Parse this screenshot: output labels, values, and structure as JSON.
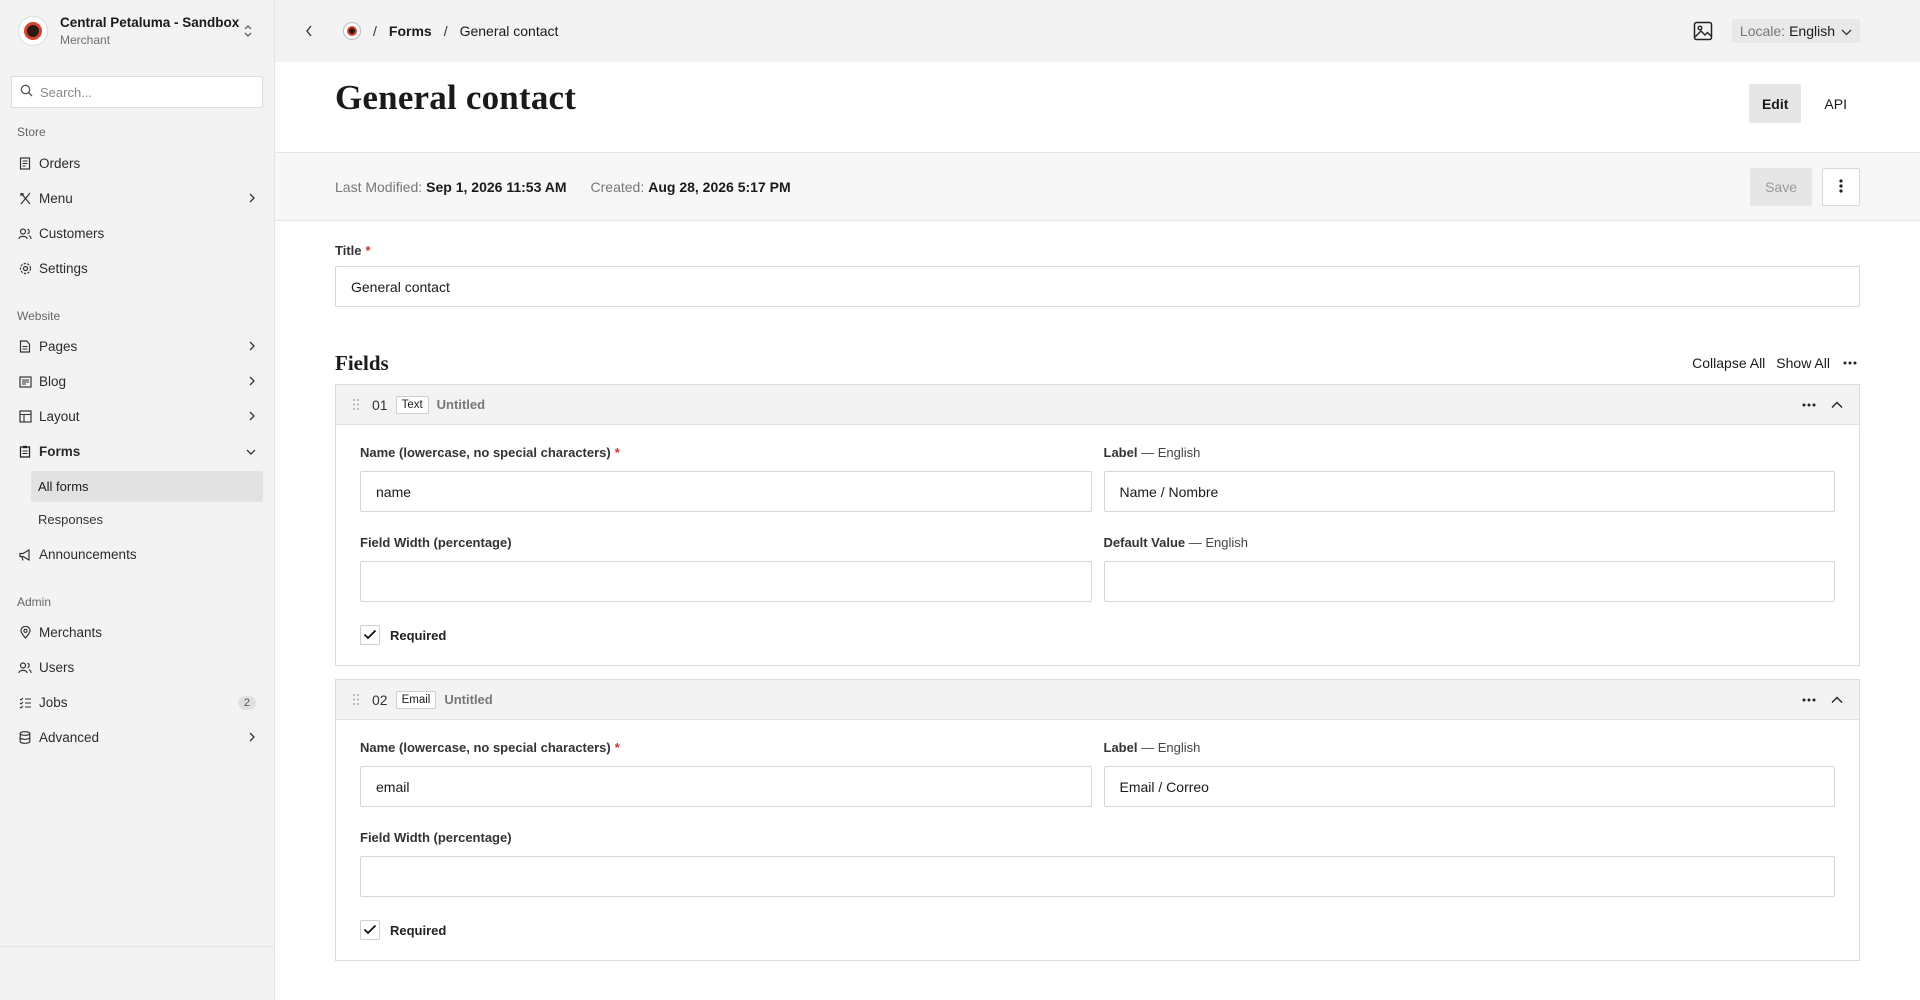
{
  "sidebar": {
    "merchant_name": "Central Petaluma - Sandbox",
    "merchant_role": "Merchant",
    "search_placeholder": "Search...",
    "sections": {
      "store": "Store",
      "website": "Website",
      "admin": "Admin"
    },
    "items": {
      "orders": "Orders",
      "menu": "Menu",
      "customers": "Customers",
      "settings": "Settings",
      "pages": "Pages",
      "blog": "Blog",
      "layout": "Layout",
      "forms": "Forms",
      "all_forms": "All forms",
      "responses": "Responses",
      "announcements": "Announcements",
      "merchants": "Merchants",
      "users": "Users",
      "jobs": "Jobs",
      "jobs_badge": "2",
      "advanced": "Advanced"
    }
  },
  "topbar": {
    "breadcrumb_sep": "/",
    "breadcrumb_forms": "Forms",
    "breadcrumb_current": "General contact",
    "locale_key": "Locale:",
    "locale_value": "English"
  },
  "page": {
    "title": "General contact",
    "tab_edit": "Edit",
    "tab_api": "API",
    "last_modified_label": "Last Modified:",
    "last_modified_value": "Sep 1, 2026 11:53 AM",
    "created_label": "Created:",
    "created_value": "Aug 28, 2026 5:17 PM",
    "save_label": "Save"
  },
  "form": {
    "title_label": "Title",
    "required_mark": "*",
    "title_value": "General contact",
    "fields_heading": "Fields",
    "collapse_all": "Collapse All",
    "show_all": "Show All",
    "fields": [
      {
        "number": "01",
        "type": "Text",
        "status": "Untitled",
        "name_label": "Name (lowercase, no special characters)",
        "name_value": "name",
        "label_label": "Label",
        "label_lang": "— English",
        "label_value": "Name / Nombre",
        "width_label": "Field Width (percentage)",
        "width_value": "",
        "default_label": "Default Value",
        "default_lang": "— English",
        "default_value": "",
        "required_label": "Required",
        "required_checked": true
      },
      {
        "number": "02",
        "type": "Email",
        "status": "Untitled",
        "name_label": "Name (lowercase, no special characters)",
        "name_value": "email",
        "label_label": "Label",
        "label_lang": "— English",
        "label_value": "Email / Correo",
        "width_label": "Field Width (percentage)",
        "width_value": "",
        "required_label": "Required",
        "required_checked": true
      }
    ]
  },
  "colors": {
    "sidebar_bg": "#f3f3f3",
    "required_red": "#d0312d",
    "logo_ring": "#d8432f"
  }
}
